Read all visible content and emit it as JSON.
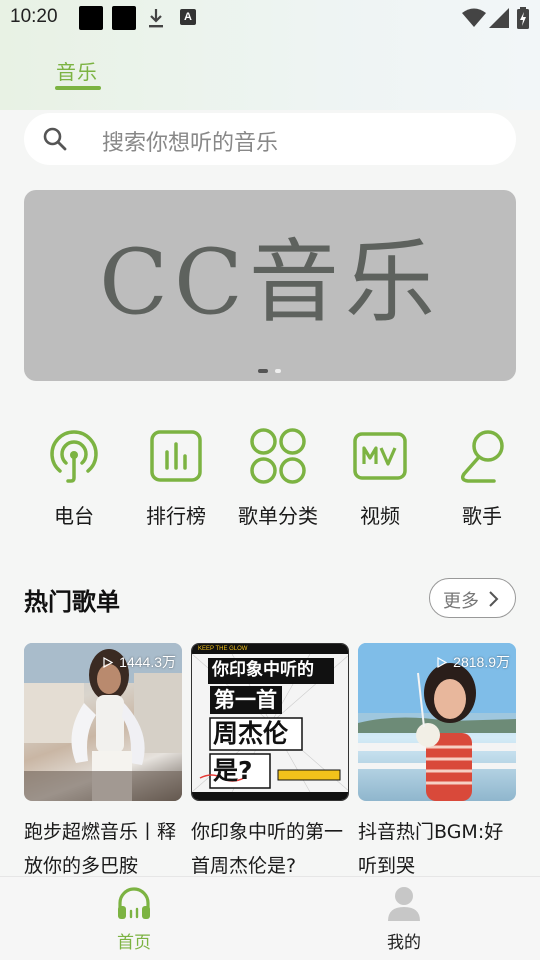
{
  "status_bar": {
    "time": "10:20",
    "notification_letter": "A"
  },
  "header": {
    "tab_label": "音乐"
  },
  "search": {
    "placeholder": "搜索你想听的音乐"
  },
  "banner": {
    "text": "CC音乐",
    "page_count": 2,
    "active_page": 1
  },
  "categories": [
    {
      "label": "电台",
      "icon": "radio-icon"
    },
    {
      "label": "排行榜",
      "icon": "chart-icon"
    },
    {
      "label": "歌单分类",
      "icon": "grid-icon"
    },
    {
      "label": "视频",
      "icon": "mv-icon"
    },
    {
      "label": "歌手",
      "icon": "singer-icon"
    }
  ],
  "hot_playlists": {
    "title": "热门歌单",
    "more_label": "更多",
    "items": [
      {
        "title": "跑步超燃音乐丨释放你的多巴胺",
        "play_count": "1444.3万"
      },
      {
        "title": "你印象中听的第一首周杰伦是?",
        "cover_text_lines": [
          "你印象中听的",
          "第一首",
          "周杰伦",
          "是?"
        ],
        "cover_border_text": "KEEP THE GLOW"
      },
      {
        "title": "抖音热门BGM:好听到哭",
        "play_count": "2818.9万"
      }
    ]
  },
  "bottom_nav": {
    "home_label": "首页",
    "mine_label": "我的"
  },
  "colors": {
    "accent": "#7cb342",
    "banner_bg": "#bdbdbd"
  }
}
